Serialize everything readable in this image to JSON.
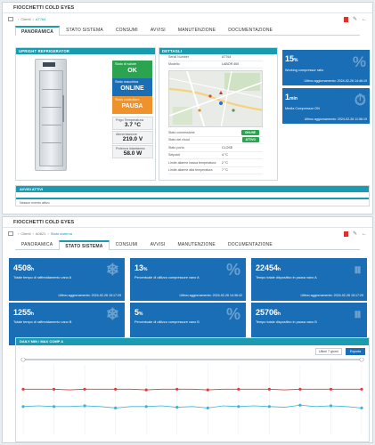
{
  "app_title": "FIOCCHETTI COLD EYES",
  "panel1": {
    "breadcrumb": [
      "Clienti",
      "A7764"
    ],
    "tabs": [
      "PANORAMICA",
      "STATO SISTEMA",
      "CONSUMI",
      "AVVISI",
      "MANUTENZIONE",
      "DOCUMENTAZIONE"
    ],
    "active_tab": 0,
    "fridge_title": "UPRIGHT REFRIGERATOR",
    "stats": [
      {
        "label": "Stato di salute",
        "value": "OK",
        "color": "#2aa44f"
      },
      {
        "label": "Stato macchina",
        "value": "ONLINE",
        "color": "#1a6eb5"
      },
      {
        "label": "Stato controllore",
        "value": "PAUSA",
        "color": "#f0922b"
      }
    ],
    "measures": [
      {
        "label": "Frigo Temperatura",
        "value": "3.7 °C"
      },
      {
        "label": "Alimentazione",
        "value": "219.0 V"
      },
      {
        "label": "Potenza istantanea",
        "value": "58.0 W"
      }
    ],
    "details_title": "DETTAGLI",
    "details_top": [
      {
        "k": "Serial Number",
        "v": "A7764"
      },
      {
        "k": "Modello",
        "v": "LABOR 400"
      },
      {
        "k": "Gateway Release",
        "v": "2.1.3"
      }
    ],
    "details_bottom": [
      {
        "k": "Stato connessione",
        "v": "ONLINE",
        "pill": true
      },
      {
        "k": "Stato del cloud",
        "v": "ATTIVO",
        "pill": true
      },
      {
        "k": "Stato porta",
        "v": "CLOSE"
      },
      {
        "k": "Setpoint",
        "v": "4 °C"
      },
      {
        "k": "Limite allarme bassa temperatura",
        "v": "2 °C"
      },
      {
        "k": "Limite allarme alta temperatura",
        "v": "7 °C"
      }
    ],
    "kpis": [
      {
        "value": "15",
        "unit": "%",
        "label": "Working compressor ratio",
        "updated": "Ultimo aggiornamento: 2024-02-26 14:46:19",
        "icon": "%"
      },
      {
        "value": "1",
        "unit": "min",
        "label": "Media Compressor ON",
        "updated": "Ultimo aggiornamento: 2024-02-26 11:56:19",
        "icon": "⏱"
      }
    ],
    "alarms_title": "AVVISI ATTIVI",
    "alarms_msg": "Nessun evento attivo"
  },
  "panel2": {
    "breadcrumb": [
      "Clienti",
      "A0621",
      "Stato sistema"
    ],
    "tabs": [
      "PANORAMICA",
      "STATO SISTEMA",
      "CONSUMI",
      "AVVISI",
      "MANUTENZIONE",
      "DOCUMENTAZIONE"
    ],
    "active_tab": 1,
    "tiles": [
      {
        "value": "4508",
        "unit": "h",
        "label": "Totale tempo di raffreddamento vano A",
        "updated": "Ultimo aggiornamento: 2024-02-26 15:17:29",
        "icon": "❄"
      },
      {
        "value": "13",
        "unit": "%",
        "label": "Percentuale di utilizzo compressore vano A",
        "updated": "Ultimo aggiornamento: 2024-02-26 14:36:42",
        "icon": "%"
      },
      {
        "value": "22454",
        "unit": "h",
        "label": "Tempo totale dispositivo in pausa vano A",
        "updated": "Ultimo aggiornamento: 2024-02-26 15:17:29",
        "icon": "⏸"
      },
      {
        "value": "1255",
        "unit": "h",
        "label": "Totale tempo di raffreddamento vano B",
        "updated": "Ultimo aggiornamento: 2024-02-26 14:51:14",
        "icon": "❄"
      },
      {
        "value": "5",
        "unit": "%",
        "label": "Percentuale di utilizzo compressore vano B",
        "updated": "Ultimo aggiornamento: 2024-02-26 14:06:42",
        "icon": "%"
      },
      {
        "value": "25706",
        "unit": "h",
        "label": "Tempo totale dispositivo in pausa vano B",
        "updated": "Ultimo aggiornamento: 2024-02-26 14:51:14",
        "icon": "⏸"
      }
    ],
    "chart_title": "DAILY MIN / MAX COMP A",
    "range_select": "Ultimi 7 giorni",
    "export_label": "Esporta"
  },
  "chart_data": {
    "type": "line",
    "x": [
      1,
      2,
      3,
      4,
      5,
      6,
      7,
      8,
      9,
      10,
      11,
      12,
      13,
      14,
      15,
      16,
      17,
      18,
      19,
      20,
      21,
      22,
      23
    ],
    "ylim": [
      0,
      10
    ],
    "series": [
      {
        "color": "#e03a3a",
        "values": [
          6.5,
          6.5,
          6.5,
          6.4,
          6.5,
          6.5,
          6.5,
          6.5,
          6.4,
          6.5,
          6.5,
          6.5,
          6.4,
          6.5,
          6.5,
          6.5,
          6.5,
          6.4,
          6.5,
          6.5,
          6.5,
          6.5,
          6.5
        ]
      },
      {
        "color": "#3ab3d9",
        "values": [
          4.0,
          4.1,
          4.0,
          4.0,
          4.1,
          4.0,
          3.8,
          4.0,
          4.0,
          4.1,
          3.9,
          4.0,
          3.8,
          4.1,
          4.0,
          4.1,
          4.0,
          3.9,
          4.2,
          4.0,
          4.1,
          4.0,
          3.8
        ]
      }
    ]
  }
}
